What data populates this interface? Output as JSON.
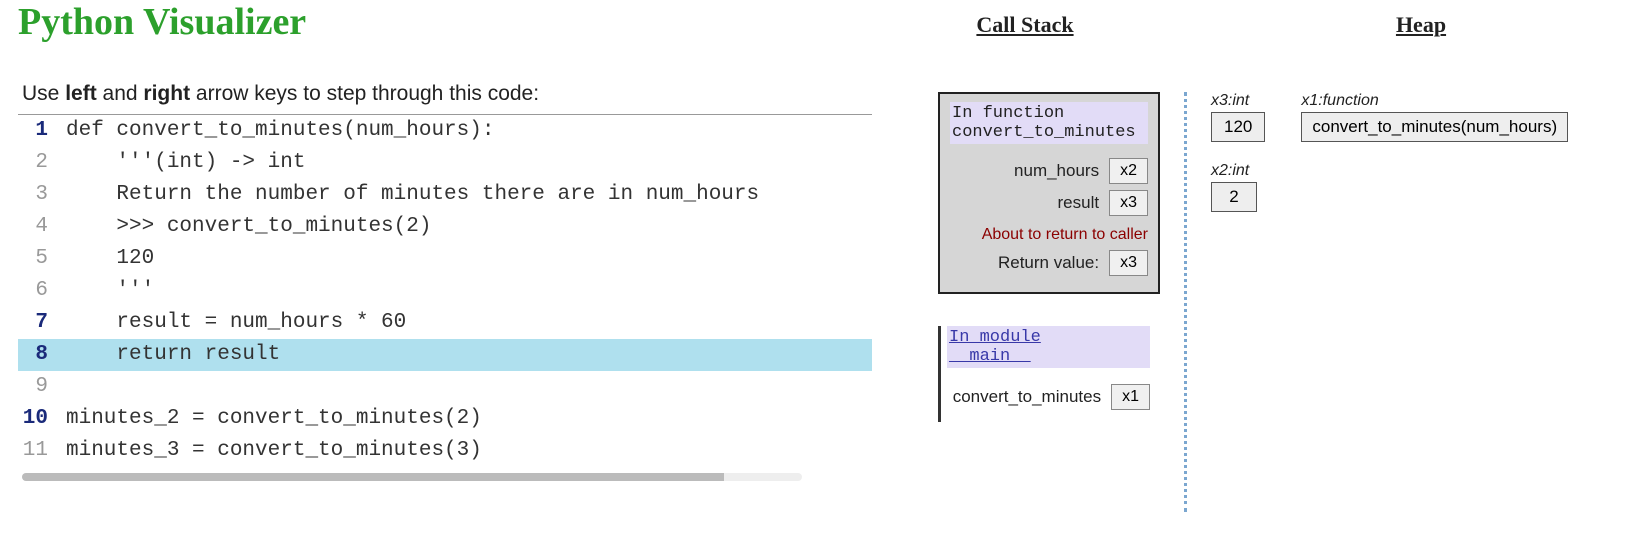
{
  "title": "Python Visualizer",
  "instructions_pre": "Use ",
  "instructions_b1": "left",
  "instructions_mid": " and ",
  "instructions_b2": "right",
  "instructions_post": " arrow keys to step through this code:",
  "code_lines": [
    {
      "num": "1",
      "text": "def convert_to_minutes(num_hours):",
      "active": true,
      "highlight": false
    },
    {
      "num": "2",
      "text": "    '''(int) -> int",
      "active": false,
      "highlight": false
    },
    {
      "num": "3",
      "text": "    Return the number of minutes there are in num_hours",
      "active": false,
      "highlight": false
    },
    {
      "num": "4",
      "text": "    >>> convert_to_minutes(2)",
      "active": false,
      "highlight": false
    },
    {
      "num": "5",
      "text": "    120",
      "active": false,
      "highlight": false
    },
    {
      "num": "6",
      "text": "    '''",
      "active": false,
      "highlight": false
    },
    {
      "num": "7",
      "text": "    result = num_hours * 60",
      "active": true,
      "highlight": false
    },
    {
      "num": "8",
      "text": "    return result",
      "active": true,
      "highlight": true
    },
    {
      "num": "9",
      "text": "",
      "active": false,
      "highlight": false
    },
    {
      "num": "10",
      "text": "minutes_2 = convert_to_minutes(2)",
      "active": true,
      "highlight": false
    },
    {
      "num": "11",
      "text": "minutes_3 = convert_to_minutes(3)",
      "active": false,
      "highlight": false
    }
  ],
  "call_stack_heading": "Call Stack",
  "heap_heading": "Heap",
  "current_frame": {
    "header_line1": "In function",
    "header_line2": "convert_to_minutes",
    "vars": [
      {
        "name": "num_hours",
        "ref": "x2"
      },
      {
        "name": "result",
        "ref": "x3"
      }
    ],
    "return_notice": "About to return to caller",
    "return_label": "Return value:",
    "return_ref": "x3"
  },
  "module_frame": {
    "header_line1": "In module",
    "header_line2": "__main__",
    "vars": [
      {
        "name": "convert_to_minutes",
        "ref": "x1"
      }
    ]
  },
  "heap_objects": {
    "x3": {
      "label": "x3:int",
      "value": "120"
    },
    "x1": {
      "label": "x1:function",
      "value": "convert_to_minutes(num_hours)"
    },
    "x2": {
      "label": "x2:int",
      "value": "2"
    }
  }
}
